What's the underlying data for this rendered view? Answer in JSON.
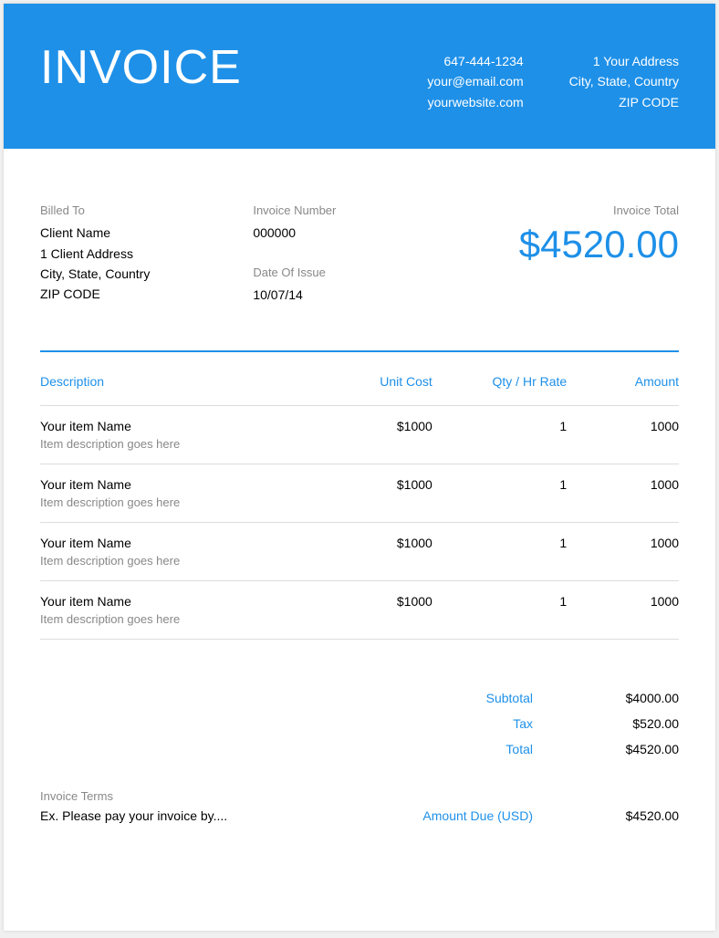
{
  "header": {
    "title": "INVOICE",
    "contact": {
      "phone": "647-444-1234",
      "email": "your@email.com",
      "website": "yourwebsite.com"
    },
    "address": {
      "line1": "1 Your Address",
      "line2": "City, State, Country",
      "line3": "ZIP CODE"
    }
  },
  "billed_to": {
    "label": "Billed To",
    "name": "Client Name",
    "address1": "1 Client Address",
    "address2": "City, State, Country",
    "zip": "ZIP CODE"
  },
  "invoice_number": {
    "label": "Invoice Number",
    "value": "000000"
  },
  "date_of_issue": {
    "label": "Date Of Issue",
    "value": "10/07/14"
  },
  "invoice_total": {
    "label": "Invoice Total",
    "value": "$4520.00"
  },
  "columns": {
    "description": "Description",
    "unit_cost": "Unit Cost",
    "qty": "Qty / Hr Rate",
    "amount": "Amount"
  },
  "items": [
    {
      "name": "Your item Name",
      "desc": "Item description goes here",
      "unit": "$1000",
      "qty": "1",
      "amount": "1000"
    },
    {
      "name": "Your item Name",
      "desc": "Item description goes here",
      "unit": "$1000",
      "qty": "1",
      "amount": "1000"
    },
    {
      "name": "Your item Name",
      "desc": "Item description goes here",
      "unit": "$1000",
      "qty": "1",
      "amount": "1000"
    },
    {
      "name": "Your item Name",
      "desc": "Item description goes here",
      "unit": "$1000",
      "qty": "1",
      "amount": "1000"
    }
  ],
  "totals": {
    "subtotal_label": "Subtotal",
    "subtotal": "$4000.00",
    "tax_label": "Tax",
    "tax": "$520.00",
    "total_label": "Total",
    "total": "$4520.00"
  },
  "terms": {
    "label": "Invoice Terms",
    "text": "Ex. Please pay your invoice by...."
  },
  "amount_due": {
    "label": "Amount Due (USD)",
    "value": "$4520.00"
  }
}
